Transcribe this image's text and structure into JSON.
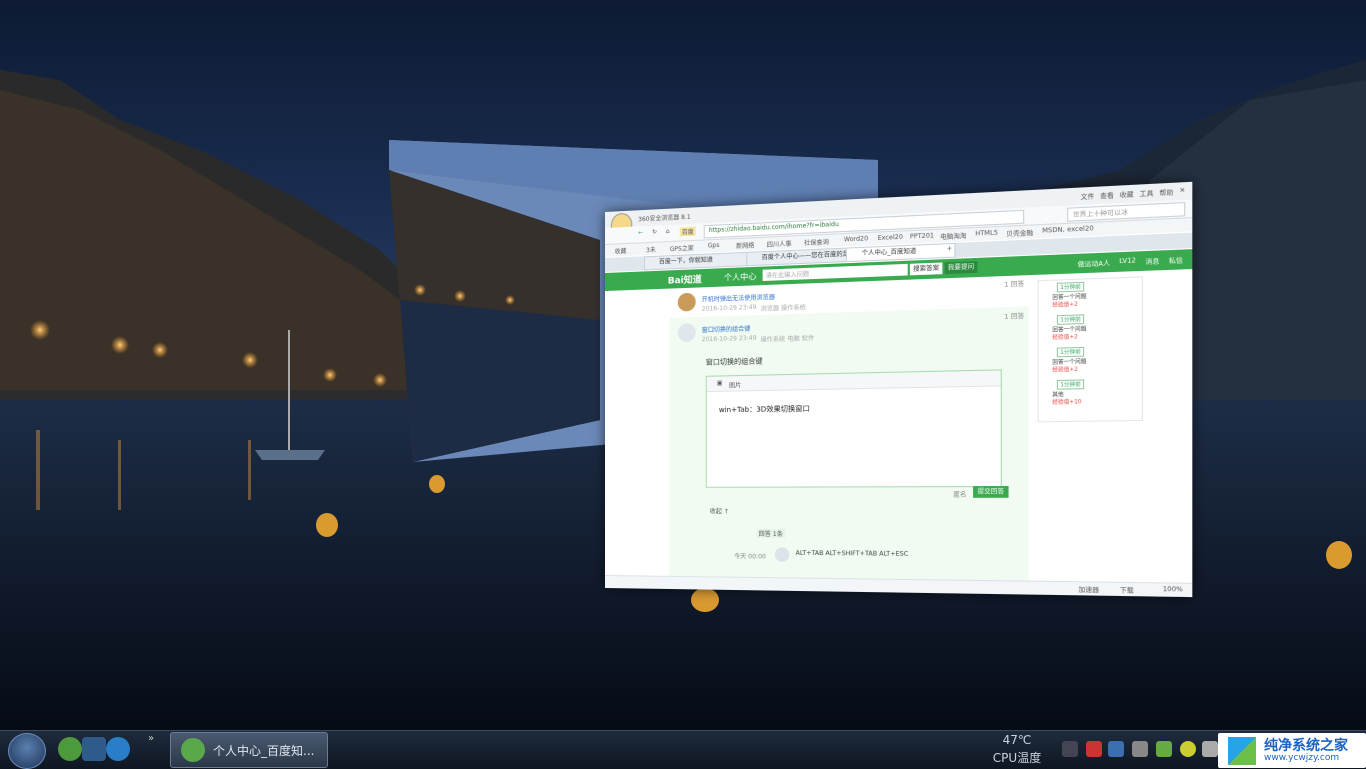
{
  "browser": {
    "app_title": "360安全浏览器 8.1",
    "window_controls": [
      "文件",
      "查看",
      "收藏",
      "工具",
      "帮助"
    ],
    "address": {
      "engine": "百度",
      "url": "https://zhidao.baidu.com/ihome?fr=ibaidu",
      "search_placeholder": "世界上十种可以冰"
    },
    "bookmarks": [
      "收藏",
      "3未",
      "GPS之家",
      "Gps",
      "新网络",
      "四川人事",
      "社保查询",
      "Word20",
      "Excel20",
      "PPT201",
      "电脑淘淘",
      "HTML5",
      "贝壳金融",
      "MSDN,",
      "excel20"
    ],
    "tabs": [
      "百度一下，你就知道",
      "百度个人中心——您在百度的足",
      "个人中心_百度知道"
    ],
    "zhidao_header": {
      "logo": "Bai知道",
      "section": "个人中心",
      "search_placeholder": "请在此输入问题",
      "search_btn": "搜索答案",
      "ask_btn": "我要提问",
      "right_links": [
        "做运动A人",
        "LV12",
        "消息",
        "私信"
      ]
    },
    "feed": [
      {
        "title": "开机时弹出无法使用浏览器",
        "meta": "2016-10-29 23:49",
        "tags": "浏览器 操作系统",
        "badge": "1 回答"
      },
      {
        "title": "窗口切换的组合键",
        "meta": "2016-10-29 23:49",
        "tags": "操作系统 电脑 软件",
        "badge": "1 回答"
      }
    ],
    "answer": {
      "question": "窗口切换的组合键",
      "panel_label": "图片",
      "content": "win+Tab：3D效果切换窗口",
      "anon_label": "匿名",
      "submit": "提交回答",
      "collapse": "收起 ↑"
    },
    "reply": {
      "tag": "回答 1条",
      "time": "今天 00:00",
      "text": "ALT+TAB ALT+SHIFT+TAB ALT+ESC"
    },
    "sidebar": [
      {
        "tag": "1分钟前",
        "line1": "回答一个问题",
        "line2": "经验值+2"
      },
      {
        "tag": "1分钟前",
        "line1": "回答一个问题",
        "line2": "经验值+2"
      },
      {
        "tag": "1分钟前",
        "line1": "回答一个问题",
        "line2": "经验值+2"
      },
      {
        "tag": "1分钟前",
        "line1": "其他",
        "line2": "经验值+10"
      }
    ],
    "status": {
      "items": [
        "加速器",
        "下载",
        "100%"
      ]
    }
  },
  "taskbar": {
    "task_label": "个人中心_百度知...",
    "temp": "47℃",
    "temp_label": "CPU温度",
    "brand_name": "纯净系统之家",
    "brand_url": "www.ycwjzy.com"
  },
  "colors": {
    "accent": "#3aaa4f",
    "taskbar": "#1b2535"
  }
}
